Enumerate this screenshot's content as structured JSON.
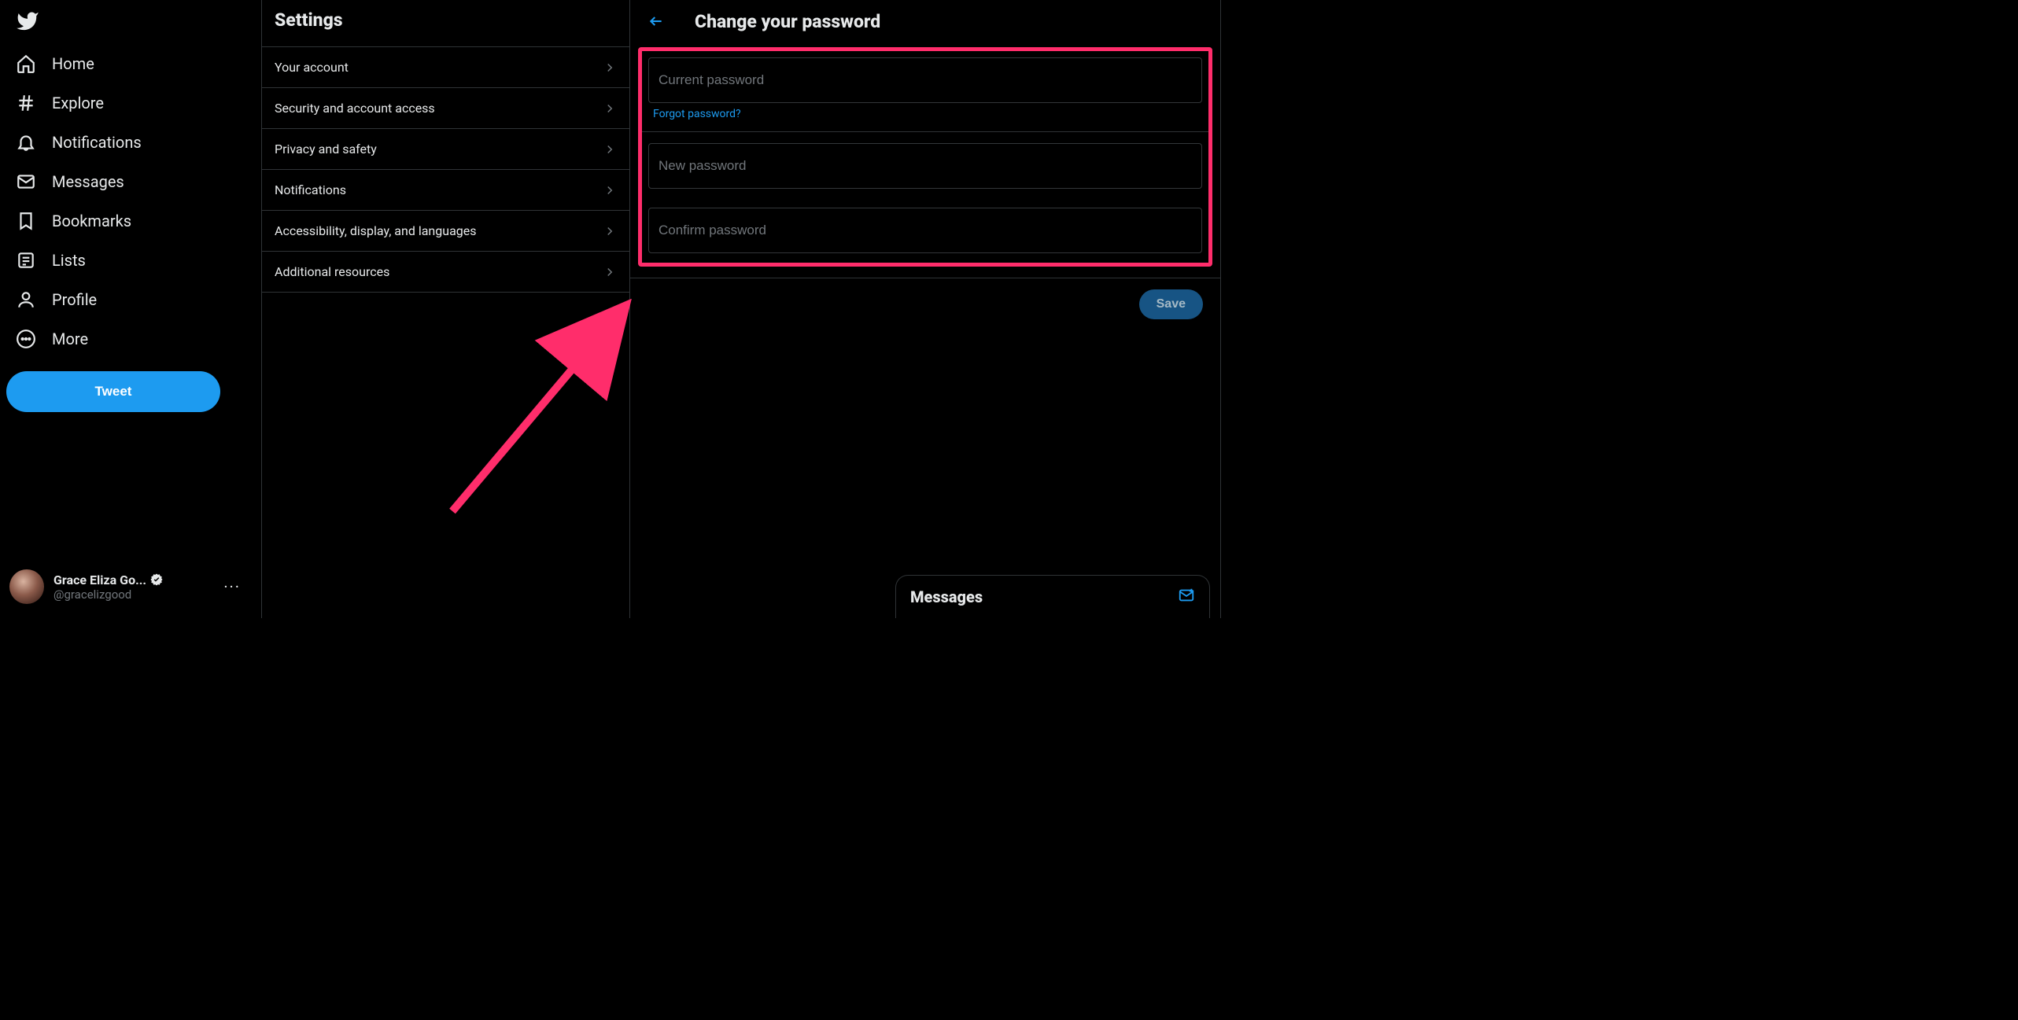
{
  "nav": {
    "home": "Home",
    "explore": "Explore",
    "notifications": "Notifications",
    "messages": "Messages",
    "bookmarks": "Bookmarks",
    "lists": "Lists",
    "profile": "Profile",
    "more": "More",
    "tweet_btn": "Tweet"
  },
  "account": {
    "name": "Grace Eliza Go...",
    "handle": "@gracelizgood"
  },
  "settings": {
    "title": "Settings",
    "items": [
      "Your account",
      "Security and account access",
      "Privacy and safety",
      "Notifications",
      "Accessibility, display, and languages",
      "Additional resources"
    ]
  },
  "detail": {
    "title": "Change your password",
    "current_placeholder": "Current password",
    "forgot": "Forgot password?",
    "new_placeholder": "New password",
    "confirm_placeholder": "Confirm password",
    "save": "Save"
  },
  "dock": {
    "title": "Messages"
  }
}
